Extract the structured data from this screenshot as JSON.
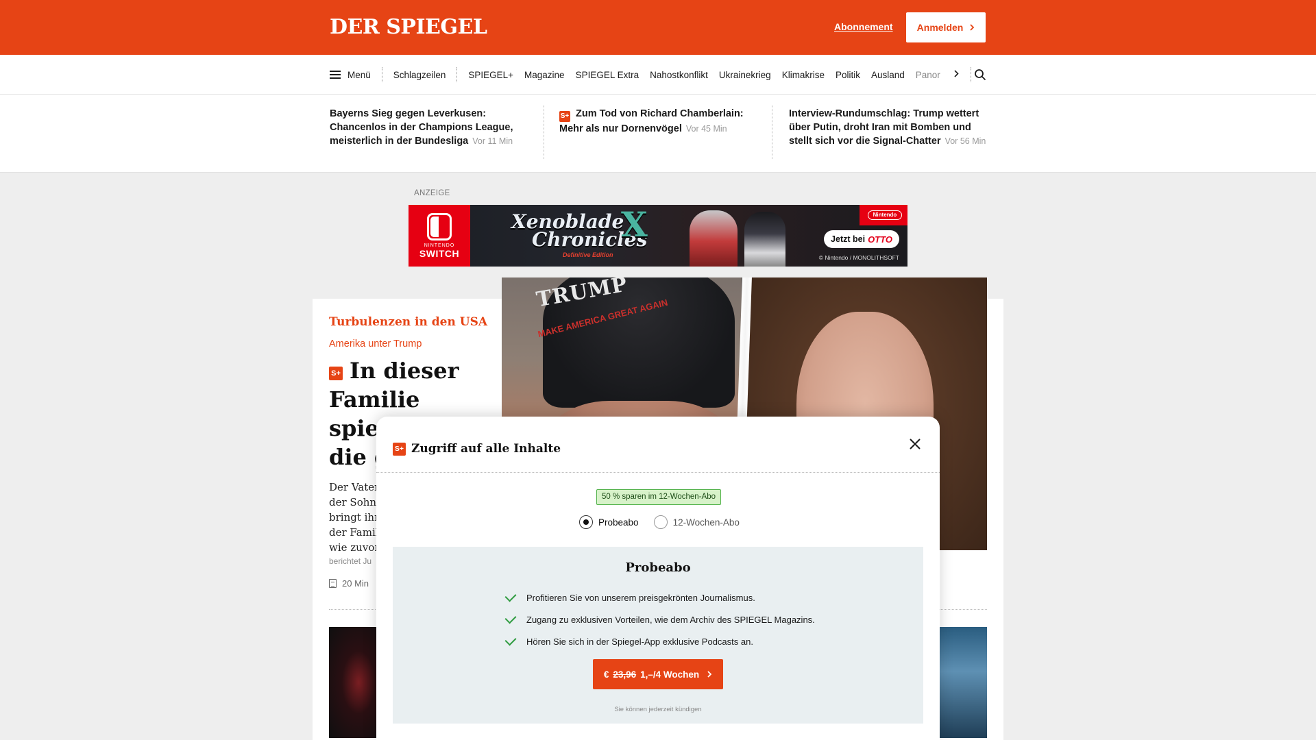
{
  "header": {
    "logo": "DER SPIEGEL",
    "subscription_link": "Abonnement",
    "login_button": "Anmelden"
  },
  "nav": {
    "menu_label": "Menü",
    "items": [
      "Schlagzeilen",
      "SPIEGEL+",
      "Magazine",
      "SPIEGEL Extra",
      "Nahostkonflikt",
      "Ukrainekrieg",
      "Klimakrise",
      "Politik",
      "Ausland",
      "Panor"
    ]
  },
  "teasers": [
    {
      "title": "Bayerns Sieg gegen Leverkusen: Chancenlos in der Champions League, meisterlich in der Bundesliga",
      "time": "Vor 11 Min",
      "plus": false
    },
    {
      "title": "Zum Tod von Richard Chamberlain: Mehr als nur Dornenvögel",
      "time": "Vor 45 Min",
      "plus": true
    },
    {
      "title": "Interview-Rundumschlag: Trump wettert über Putin, droht Iran mit Bomben und stellt sich vor die Signal-Chatter",
      "time": "Vor 56 Min",
      "plus": false
    }
  ],
  "ad": {
    "label": "ANZEIGE",
    "platform_small": "NINTENDO",
    "platform": "SWITCH",
    "game_title_line1": "Xenoblade",
    "game_title_line2": "Chronicles",
    "game_x": "X",
    "edition": "Definitive Edition",
    "brand_badge": "Nintendo",
    "cta_prefix": "Jetzt bei",
    "cta_brand": "OTTO",
    "copyright": "© Nintendo / MONOLITHSOFT"
  },
  "article": {
    "kicker": "Turbulenzen in den USA",
    "subkicker": "Amerika unter Trump",
    "headline": "In dieser Familie spiegelt sich die ganz der U",
    "lead_lines": [
      "Der Vater",
      "der Sohn",
      "bringt ihn",
      "der Famili",
      "wie zuvor"
    ],
    "byline": "berichtet Ju",
    "read_time": "20 Min",
    "hero_cap_text": "TRUMP",
    "hero_cap_slogan": "MAKE AMERICA GREAT AGAIN"
  },
  "modal": {
    "title": "Zugriff auf alle Inhalte",
    "plus_badge": "S+",
    "save_badge": "50 % sparen im 12-Wochen-Abo",
    "options": [
      {
        "label": "Probeabo",
        "checked": true
      },
      {
        "label": "12-Wochen-Abo",
        "checked": false
      }
    ],
    "plan_title": "Probeabo",
    "benefits": [
      "Profitieren Sie von unserem preisgekrönten Journalismus.",
      "Zugang zu exklusiven Vorteilen, wie dem Archiv des SPIEGEL Magazins.",
      "Hören Sie sich in der Spiegel-App exklusive Podcasts an."
    ],
    "cta_currency": "€",
    "cta_old_price": "23,96",
    "cta_new_price": "1,–/4 Wochen",
    "cancel_note": "Sie können jederzeit kündigen"
  },
  "colors": {
    "brand": "#e64415",
    "success_bg": "#d7f2c9",
    "success_border": "#52b24a",
    "check": "#2e9b3f",
    "plan_bg": "#e9eff1"
  }
}
